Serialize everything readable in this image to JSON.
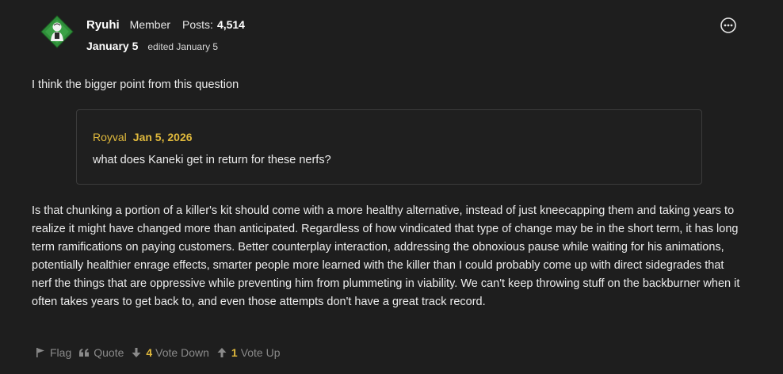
{
  "author": {
    "name": "Ryuhi",
    "role": "Member",
    "posts_label": "Posts:",
    "posts_count": "4,514"
  },
  "post": {
    "date": "January 5",
    "edited": "edited January 5",
    "intro": "I think the bigger point from this question",
    "body": "Is that chunking a portion of a killer's kit should come with a more healthy alternative, instead of just kneecapping them and taking years to realize it might have changed more than anticipated. Regardless of how vindicated that type of change may be in the short term, it has long term ramifications on paying customers. Better counterplay interaction, addressing the obnoxious pause while waiting for his animations, potentially healthier enrage effects, smarter people more learned with the killer than I could probably come up with direct sidegrades that nerf the things that are oppressive while preventing him from plummeting in viability. We can't keep throwing stuff on the backburner when it often takes years to get back to, and even those attempts don't have a great track record."
  },
  "quote": {
    "author": "Royval",
    "date": "Jan 5, 2026",
    "text": "what does Kaneki get in return for these nerfs?"
  },
  "reactions": {
    "flag": {
      "label": "Flag",
      "icon": "flag-icon"
    },
    "quote": {
      "label": "Quote",
      "icon": "quote-icon"
    },
    "vote_down": {
      "label": "Vote Down",
      "count": "4",
      "icon": "arrow-down-icon"
    },
    "vote_up": {
      "label": "Vote Up",
      "count": "1",
      "icon": "arrow-up-icon"
    }
  },
  "colors": {
    "background": "#1e1e1e",
    "accent": "#e0b93c",
    "text": "#ececec",
    "muted": "#8a8a8a",
    "quote_border": "#3c3c3c"
  }
}
